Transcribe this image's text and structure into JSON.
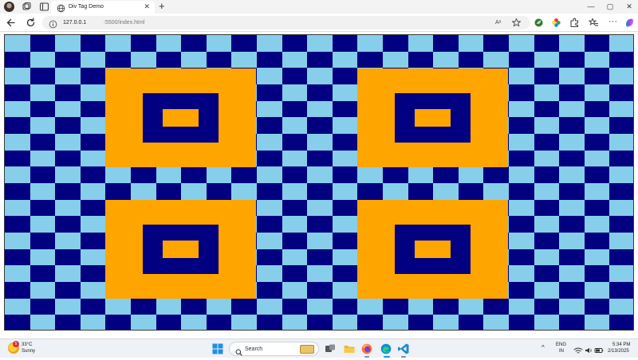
{
  "browser": {
    "tab_title": "Div Tag Demo",
    "tab_close": "✕",
    "new_tab": "+",
    "window_controls": {
      "minimize": "—",
      "maximize": "▢",
      "close": "✕"
    },
    "url_host": "127.0.0.1",
    "url_rest": ":5500/index.html",
    "read_aloud": "Aᵃ",
    "more_menu": "···",
    "icons": {
      "profile": "profile-avatar",
      "workspaces": "workspaces-icon",
      "tab_actions": "vertical-tabs-icon",
      "back": "back-arrow-icon",
      "refresh": "refresh-icon",
      "site_info": "info-icon",
      "favorite": "star-icon"
    }
  },
  "page": {
    "colors": {
      "light": "#87ceeb",
      "dark": "#000080",
      "accent": "#ffa500"
    }
  },
  "taskbar": {
    "weather_temp": "33°C",
    "weather_desc": "Sunny",
    "weather_badge": "5",
    "search_label": "Search",
    "lang_top": "ENG",
    "lang_bottom": "IN",
    "tray_chevron": "^",
    "time": "5:34 PM",
    "date": "2/13/2025",
    "apps": [
      "task-view",
      "file-explorer",
      "firefox",
      "edge",
      "vscode"
    ]
  }
}
